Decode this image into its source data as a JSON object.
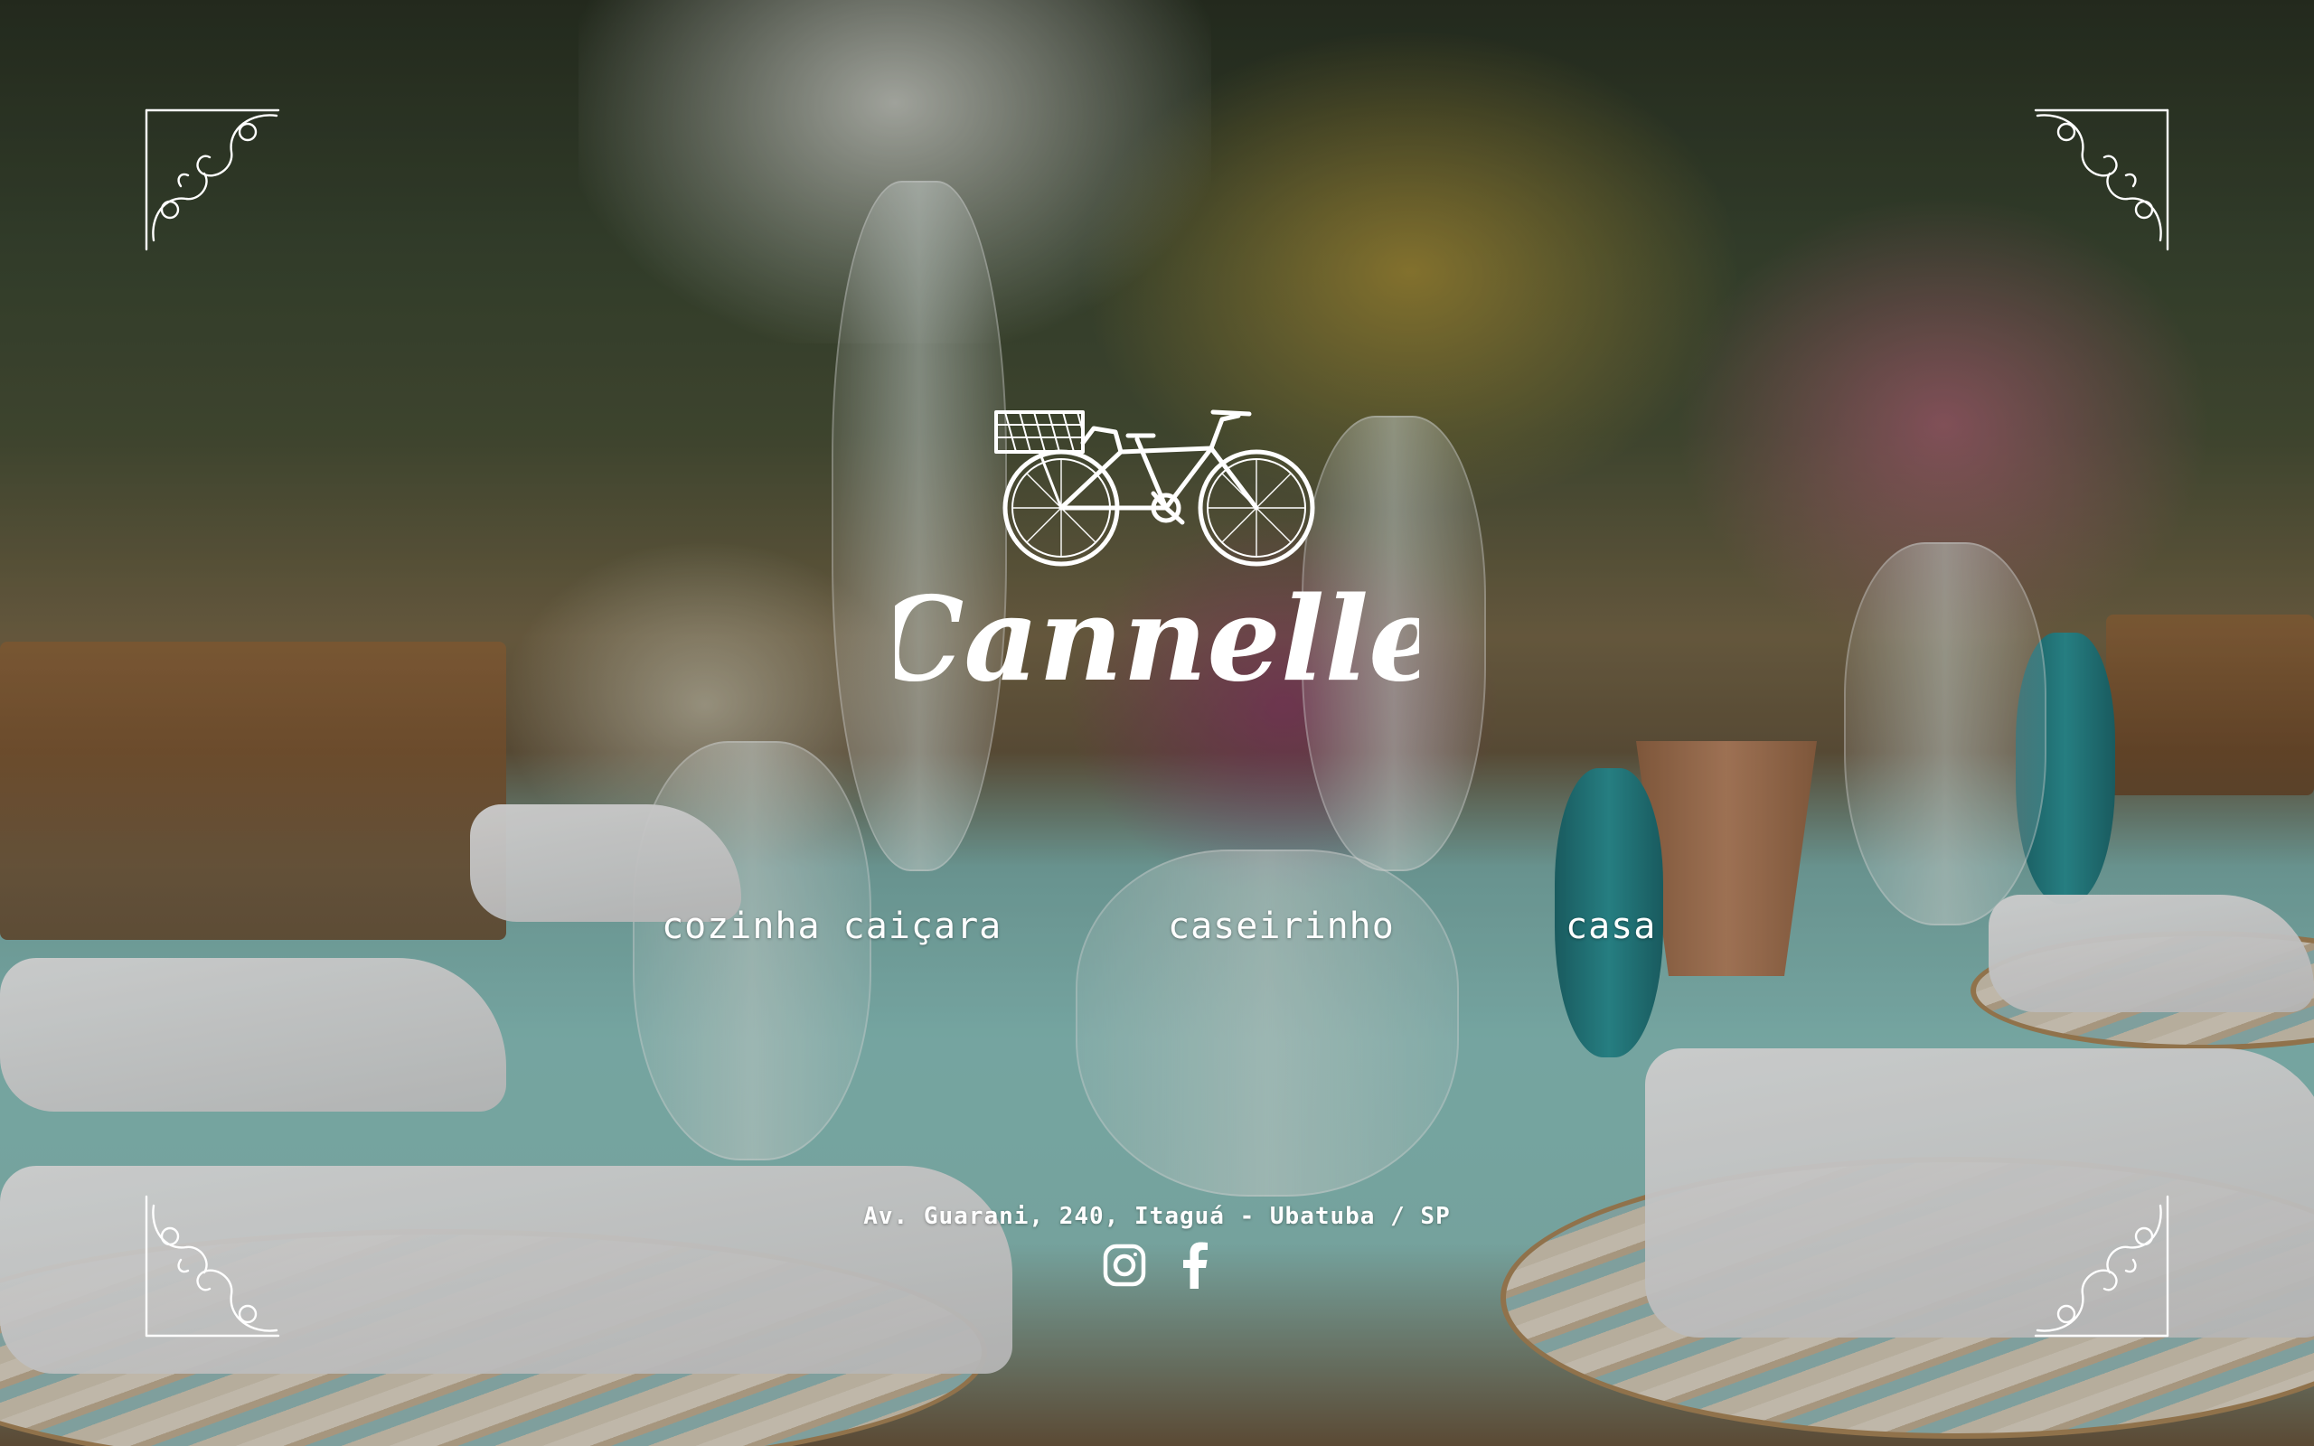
{
  "brand": {
    "name": "Cannelle",
    "logo_icon": "bicycle-with-basket-icon"
  },
  "nav": {
    "items": [
      {
        "label": "cozinha caiçara"
      },
      {
        "label": "caseirinho"
      },
      {
        "label": "casa"
      }
    ]
  },
  "footer": {
    "address": "Av. Guarani, 240, Itaguá - Ubatuba / SP",
    "social": [
      {
        "icon": "instagram-icon"
      },
      {
        "icon": "facebook-icon"
      }
    ]
  },
  "decor": {
    "corner_ornament_icon": "scroll-flourish-icon"
  },
  "colors": {
    "text": "#ffffff",
    "table_runner": "#8fc9c4"
  }
}
